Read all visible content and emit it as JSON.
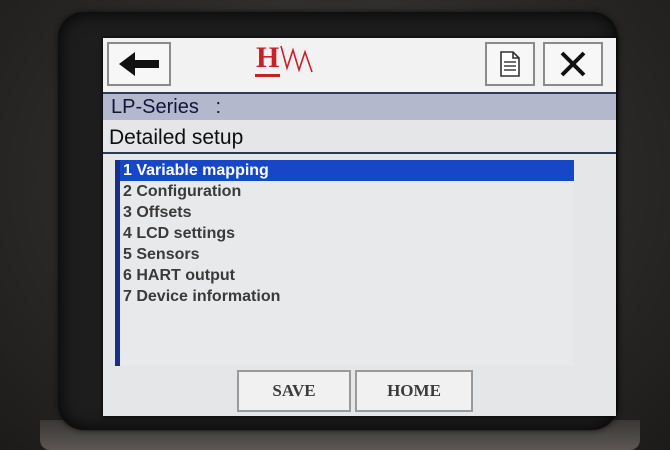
{
  "header": {
    "back_icon": "arrow-left-icon",
    "logo_letter": "H",
    "doc_icon": "document-icon",
    "close_icon": "close-icon",
    "title": "LP-Series   :",
    "subtitle": "Detailed setup"
  },
  "menu": {
    "items": [
      {
        "label": "1 Variable mapping",
        "selected": true
      },
      {
        "label": "2 Configuration",
        "selected": false
      },
      {
        "label": "3 Offsets",
        "selected": false
      },
      {
        "label": "4 LCD settings",
        "selected": false
      },
      {
        "label": "5 Sensors",
        "selected": false
      },
      {
        "label": "6 HART output",
        "selected": false
      },
      {
        "label": "7 Device information",
        "selected": false
      }
    ]
  },
  "footer": {
    "save_label": "SAVE",
    "home_label": "HOME"
  },
  "colors": {
    "selection": "#1746c6",
    "title_bar": "#b4b8cc",
    "logo_red": "#c8202a"
  }
}
